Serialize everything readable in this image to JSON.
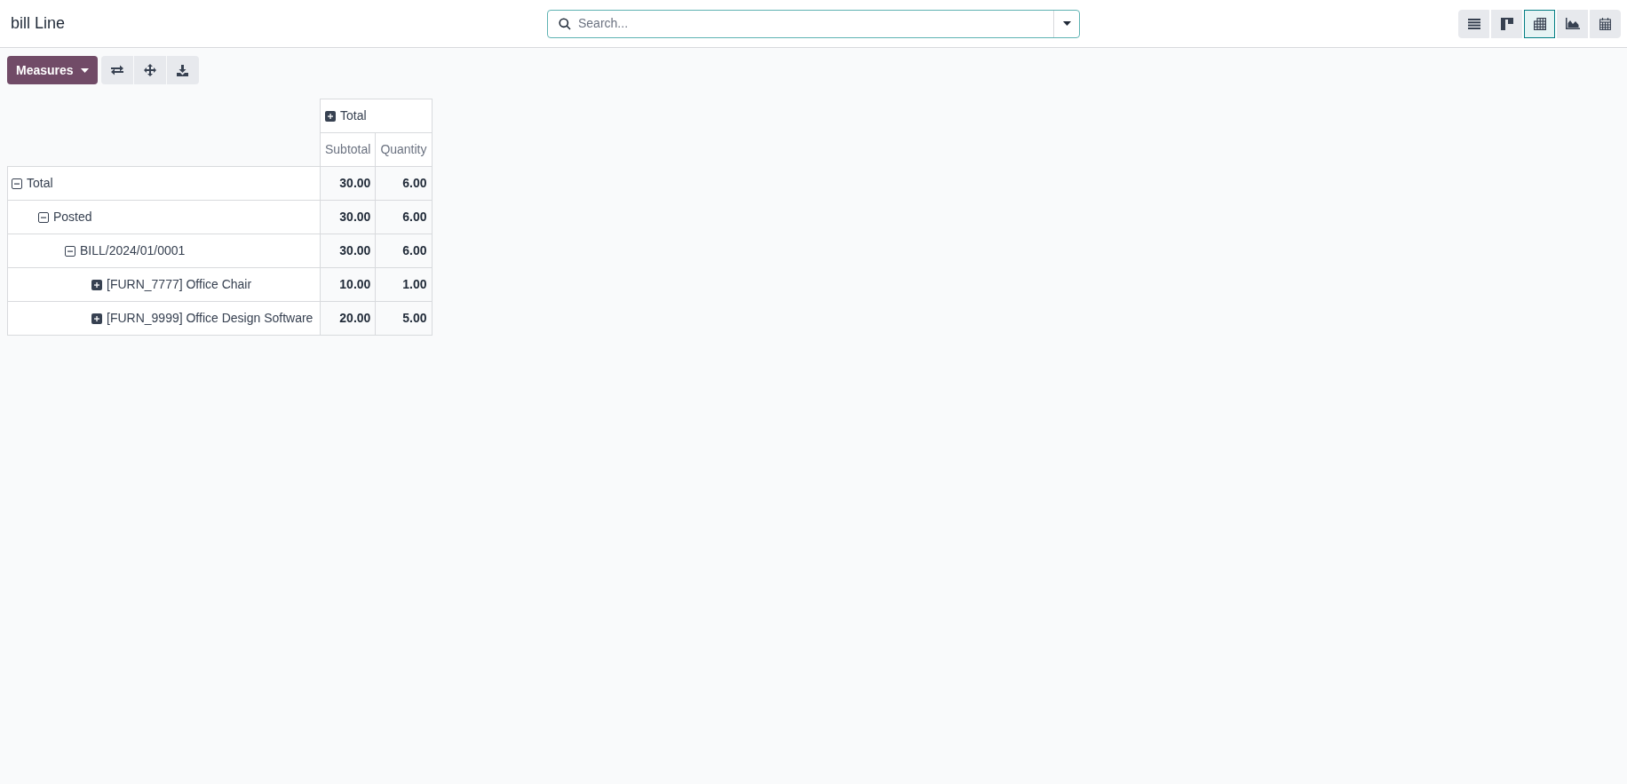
{
  "title": "bill Line",
  "search": {
    "placeholder": "Search..."
  },
  "views": [
    {
      "kind": "list",
      "selected": false
    },
    {
      "kind": "kanban",
      "selected": false
    },
    {
      "kind": "pivot",
      "selected": true
    },
    {
      "kind": "graph",
      "selected": false
    },
    {
      "kind": "calendar",
      "selected": false
    }
  ],
  "toolbar": {
    "measures": "Measures",
    "actions": [
      {
        "kind": "flip"
      },
      {
        "kind": "expand"
      },
      {
        "kind": "download"
      }
    ]
  },
  "pivot": {
    "column_header": {
      "label": "Total",
      "expanded": false
    },
    "measures": [
      "Subtotal",
      "Quantity"
    ],
    "rows": [
      {
        "label": "Total",
        "expanded": true,
        "values": [
          "30.00",
          "6.00"
        ],
        "children": [
          {
            "label": "Posted",
            "expanded": true,
            "values": [
              "30.00",
              "6.00"
            ],
            "children": [
              {
                "label": "BILL/2024/01/0001",
                "expanded": true,
                "values": [
                  "30.00",
                  "6.00"
                ],
                "children": [
                  {
                    "label": "[FURN_7777] Office Chair",
                    "expanded": false,
                    "values": [
                      "10.00",
                      "1.00"
                    ]
                  },
                  {
                    "label": "[FURN_9999] Office Design Software",
                    "expanded": false,
                    "values": [
                      "20.00",
                      "5.00"
                    ]
                  }
                ]
              }
            ]
          }
        ]
      }
    ]
  }
}
